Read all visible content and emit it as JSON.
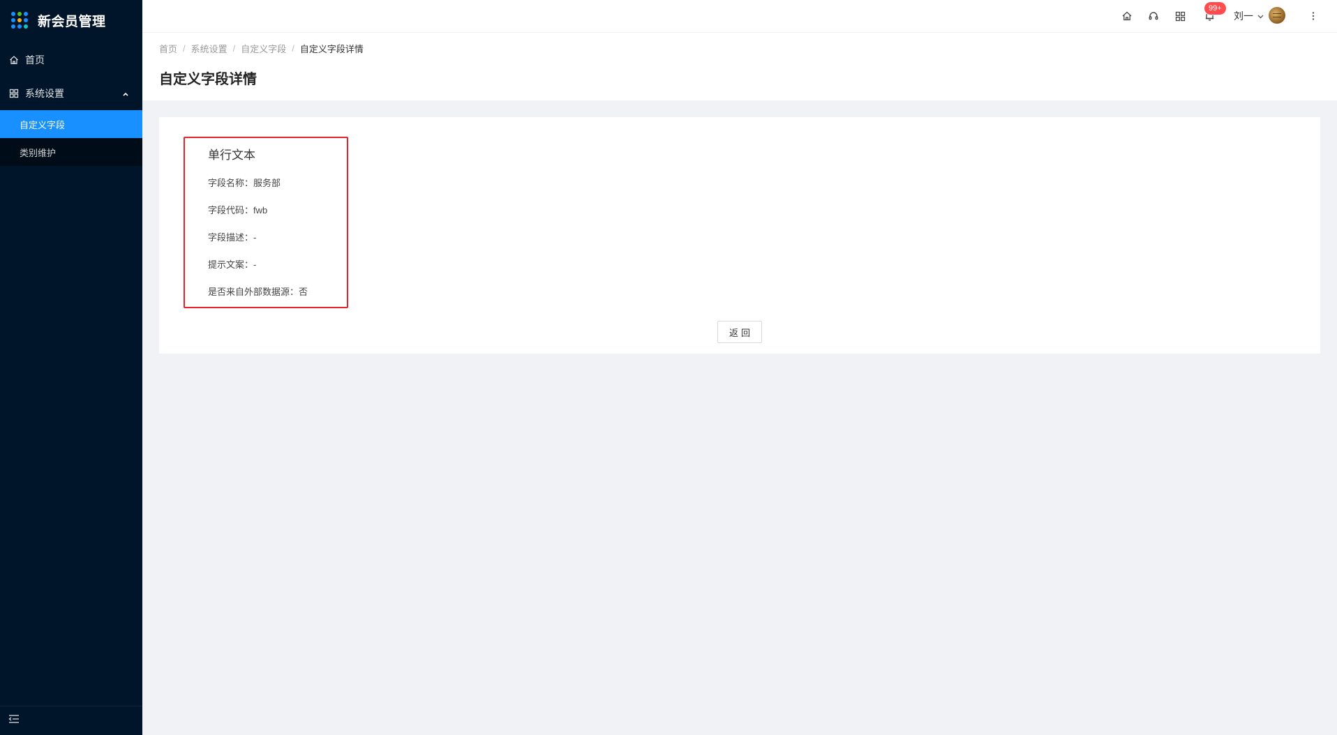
{
  "app": {
    "title": "新会员管理",
    "logo_colors": [
      "#1890ff",
      "#52c41a",
      "#1890ff",
      "#1890ff",
      "#faad14",
      "#1890ff",
      "#1890ff",
      "#1890ff",
      "#13c2c2"
    ]
  },
  "sidebar": {
    "items": [
      {
        "label": "首页",
        "icon": "home-icon"
      },
      {
        "label": "系统设置",
        "icon": "settings-grid-icon",
        "expanded": true,
        "children": [
          {
            "label": "自定义字段",
            "active": true
          },
          {
            "label": "类别维护",
            "active": false
          }
        ]
      }
    ],
    "collapse_icon": "menu-fold-icon"
  },
  "header": {
    "icons": [
      "home-icon",
      "headset-icon",
      "apps-grid-icon",
      "bell-icon",
      "more-vertical-icon"
    ],
    "notification_badge": "99+",
    "user_name": "刘一"
  },
  "breadcrumb": [
    "首页",
    "系统设置",
    "自定义字段",
    "自定义字段详情"
  ],
  "page_title": "自定义字段详情",
  "detail": {
    "field_type": "单行文本",
    "rows": [
      {
        "label": "字段名称：",
        "value": "服务部"
      },
      {
        "label": "字段代码：",
        "value": "fwb"
      },
      {
        "label": "字段描述：",
        "value": "-"
      },
      {
        "label": "提示文案：",
        "value": "-"
      },
      {
        "label": "是否来自外部数据源：",
        "value": "否"
      }
    ],
    "back_button": "返回"
  },
  "colors": {
    "sidebar_bg": "#001529",
    "active_menu": "#1890ff",
    "highlight_border": "#e8222b",
    "badge": "#ff4d4f"
  }
}
